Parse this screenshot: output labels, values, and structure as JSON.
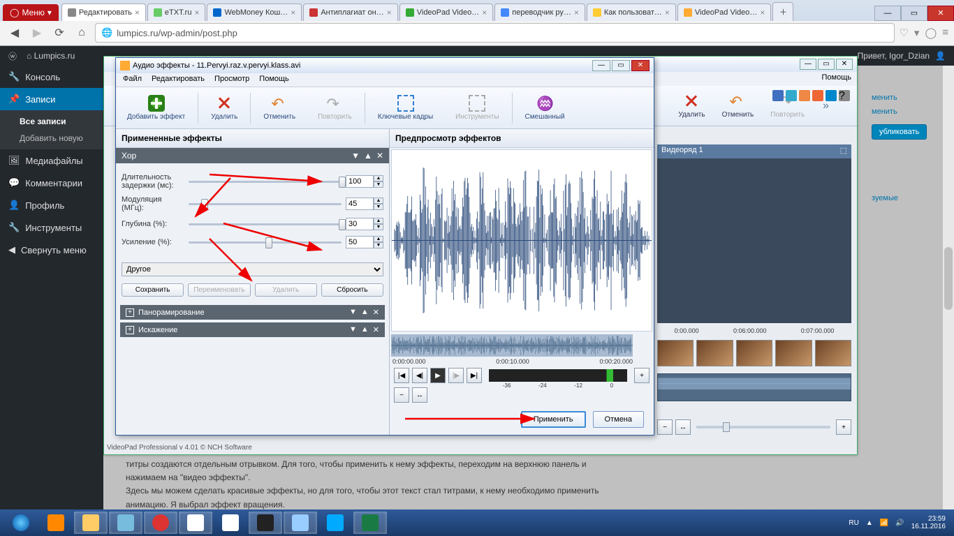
{
  "browser": {
    "menu": "Меню",
    "tabs": [
      {
        "label": "Редактировать",
        "active": true
      },
      {
        "label": "eTXT.ru"
      },
      {
        "label": "WebMoney Кош…"
      },
      {
        "label": "Антиплагиат он…"
      },
      {
        "label": "VideoPad Video…"
      },
      {
        "label": "переводчик ру…"
      },
      {
        "label": "Как пользоват…"
      },
      {
        "label": "VideoPad Video…"
      }
    ],
    "url": "lumpics.ru/wp-admin/post.php"
  },
  "wp": {
    "site": "Lumpics.ru",
    "greeting": "Привет, Igor_Dzian",
    "menu": {
      "console": "Консоль",
      "posts": "Записи",
      "all_posts": "Все записи",
      "add_new": "Добавить новую",
      "media": "Медиафайлы",
      "comments": "Комментарии",
      "profile": "Профиль",
      "tools": "Инструменты",
      "collapse": "Свернуть меню"
    },
    "right": {
      "l1": "менить",
      "l2": "менить",
      "publish": "убликовать",
      "l3": "зуемые"
    }
  },
  "content_text": {
    "l1": "титры создаются отдельным отрывком. Для того, чтобы применить к нему эффекты, переходим на верхнюю панель и",
    "l2": "нажимаем на \"видео эффекты\".",
    "l3": "Здесь мы можем сделать красивые эффекты, но для того, чтобы этот текст стал титрами, к нему необходимо применить",
    "l4": "анимацию. Я выбрал эффект вращения."
  },
  "vp_outer": {
    "menu_help": "Помощь",
    "tools": {
      "delete": "Удалить",
      "undo": "Отменить",
      "redo": "Повторить"
    },
    "track": "Видеоряд 1",
    "times": [
      "0:00.000",
      "0:06:00.000",
      "0:07:00.000"
    ],
    "status": "VideoPad Professional v 4.01 © NCH Software"
  },
  "ae": {
    "title": "Аудио эффекты - 11.Pervyi.raz.v.pervyi.klass.avi",
    "menu": {
      "file": "Файл",
      "edit": "Редактировать",
      "view": "Просмотр",
      "help": "Помощь"
    },
    "toolbar": {
      "add": "Добавить эффект",
      "delete": "Удалить",
      "undo": "Отменить",
      "redo": "Повторить",
      "keyframes": "Ключевые кадры",
      "tools": "Инструменты",
      "mix": "Смешанный"
    },
    "left_header": "Примененные эффекты",
    "right_header": "Предпросмотр эффектов",
    "effect_name": "Хор",
    "params": {
      "delay": {
        "label": "Длительность задержки (мс):",
        "value": "100",
        "thumb": 98
      },
      "mod": {
        "label": "Модуляция (МГц):",
        "value": "45",
        "thumb": 8
      },
      "depth": {
        "label": "Глубина (%):",
        "value": "30",
        "thumb": 98
      },
      "gain": {
        "label": "Усиление (%):",
        "value": "50",
        "thumb": 50
      }
    },
    "preset_group": "Другое",
    "preset_btns": {
      "save": "Сохранить",
      "rename": "Переименовать",
      "delete": "Удалить",
      "reset": "Сбросить"
    },
    "collapsed": {
      "pan": "Панорамирование",
      "dist": "Искажение"
    },
    "times": [
      "0:00:00.000",
      "0:00:10.000",
      "0:00:20.000"
    ],
    "meter_ticks": [
      "-36",
      "-24",
      "-12",
      "0"
    ],
    "apply": "Применить",
    "cancel": "Отмена"
  },
  "taskbar": {
    "lang": "RU",
    "time": "23:59",
    "date": "16.11.2016"
  }
}
